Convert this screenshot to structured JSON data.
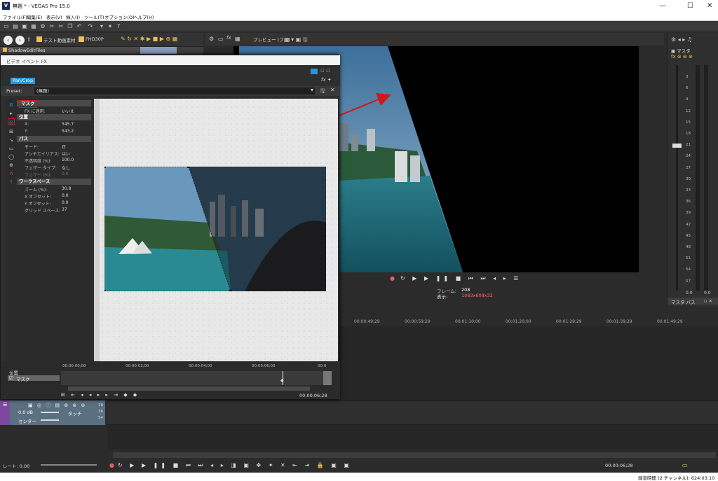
{
  "app": {
    "title": "無題 * - VEGAS Pro 15.0",
    "icon_letter": "V",
    "window_buttons": [
      "—",
      "☐",
      "✕"
    ]
  },
  "menu": [
    "ファイル(F)",
    "編集(E)",
    "表示(V)",
    "挿入(I)",
    "ツール(T)",
    "オプション(O)",
    "ヘルプ(H)"
  ],
  "explorer": {
    "folder1": "テスト動画素材",
    "folder2": "FHD30P",
    "root": "ShadowEditFiles"
  },
  "fx": {
    "window_title": "ビデオ イベント FX",
    "plugin_chip": "Pan/Crop",
    "preset_label": "Preset:",
    "preset_value": "(無題)",
    "sections": {
      "mask": "マスク",
      "fx_apply_label": "FX に適用:",
      "fx_apply_value": "いいえ",
      "position": "位置",
      "x_label": "X:",
      "x_value": "545.7",
      "y_label": "Y:",
      "y_value": "543.2",
      "path": "パス",
      "mode_label": "モード:",
      "mode_value": "正",
      "antialias_label": "アンチエイリアス:",
      "antialias_value": "はい",
      "opacity_label": "不透明度 (%):",
      "opacity_value": "100.0",
      "feather_type_label": "フェザー タイプ:",
      "feather_type_value": "なし",
      "feather_label": "フェザー (%):",
      "feather_value": "0.0",
      "workspace": "ワークスペース",
      "zoom_label": "ズーム (%):",
      "zoom_value": "30.8",
      "xoffset_label": "X オフセット:",
      "xoffset_value": "0.0",
      "yoffset_label": "Y オフセット:",
      "yoffset_value": "0.0",
      "grid_label": "グリッド スペース:",
      "grid_value": "37"
    },
    "timeline": {
      "ticks": [
        "00:00:00;00",
        "00:00:02;00",
        "00:00:04;00",
        "00:00:06;00",
        "00:0"
      ],
      "tracks": [
        "位置",
        "マスク"
      ],
      "time": "00:00:06;28"
    }
  },
  "preview": {
    "toolbar_label": "プレビュー (フル)",
    "frame_label": "フレーム:",
    "frame_value": "208",
    "display_label": "表示:",
    "display_value": "1083x609x32"
  },
  "mixer": {
    "title": "マスタ",
    "scale": [
      "3",
      "6",
      "9",
      "12",
      "15",
      "18",
      "21",
      "24",
      "27",
      "30",
      "33",
      "36",
      "39",
      "42",
      "45",
      "48",
      "51",
      "54",
      "57"
    ],
    "values": [
      "0.0",
      "0.0"
    ],
    "footer": "マスタ バス"
  },
  "timeline": {
    "ticks": [
      "00:00:49;29",
      "00:00:59;29",
      "00:01:10;00",
      "00:01:20;00",
      "00:01:29;29",
      "00:01:39;29",
      "00:01:49;29"
    ],
    "track": {
      "volume": "0.0 dB",
      "pan": "センター",
      "mode": "タッチ",
      "numbers": [
        "18",
        "36",
        "54"
      ]
    },
    "rate_label": "レート: 0.00",
    "time": "00:00:06;28",
    "end_time": "00:00:06;28"
  },
  "status": {
    "text": "録音時間 (2 チャンネル): 624:03:10"
  },
  "colors": {
    "accent": "#2596d6",
    "annotation_red": "#d01818",
    "track_header": "#5a6f80",
    "track_accent": "#7b4aa0"
  }
}
